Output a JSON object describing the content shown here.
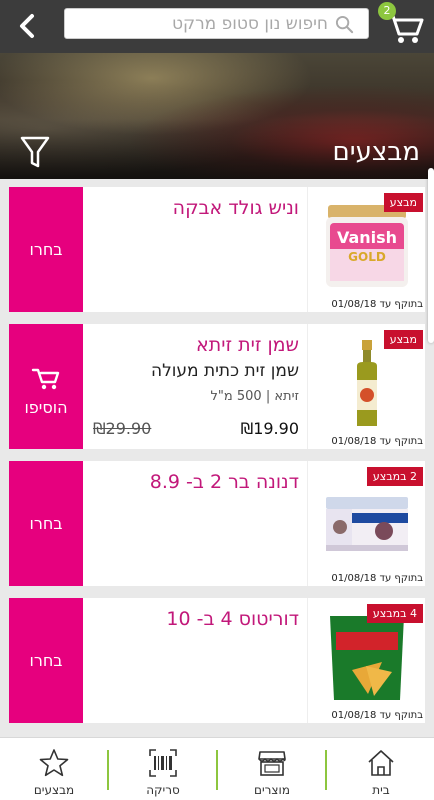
{
  "header": {
    "back_icon": "chevron-left-icon",
    "search_placeholder": "חיפוש נון סטופ מרקט",
    "cart_icon": "shopping-cart-icon",
    "cart_count": "2",
    "accent": "#8dc63f"
  },
  "hero": {
    "title": "מבצעים",
    "filter_icon": "filter-icon"
  },
  "offers": [
    {
      "name": "וניש גולד אבקה",
      "badge": "מבצע",
      "valid": "בתוקף עד 01/08/18",
      "action_label": "בחרו"
    },
    {
      "name": "שמן זית זיתא",
      "description": "שמן זית כתית מעולה",
      "brand_size": "זיתא | 500 מ\"ל",
      "price": "₪19.90",
      "old_price": "₪29.90",
      "badge": "מבצע",
      "valid": "בתוקף עד 01/08/18",
      "action_label": "הוסיפו"
    },
    {
      "name": "דנונה בר 2 ב- 8.9",
      "badge": "2 במבצע",
      "valid": "בתוקף עד 01/08/18",
      "action_label": "בחרו"
    },
    {
      "name": "דוריטוס 4 ב- 10",
      "badge": "4 במבצע",
      "valid": "בתוקף עד 01/08/18",
      "action_label": "בחרו"
    }
  ],
  "bottom_nav": [
    {
      "label": "מבצעים",
      "icon": "star-icon"
    },
    {
      "label": "סריקה",
      "icon": "barcode-icon"
    },
    {
      "label": "מוצרים",
      "icon": "store-icon"
    },
    {
      "label": "בית",
      "icon": "home-icon"
    }
  ],
  "colors": {
    "brand_magenta": "#e6007e",
    "product_name": "#c2187a",
    "badge_red": "#c8102e"
  }
}
